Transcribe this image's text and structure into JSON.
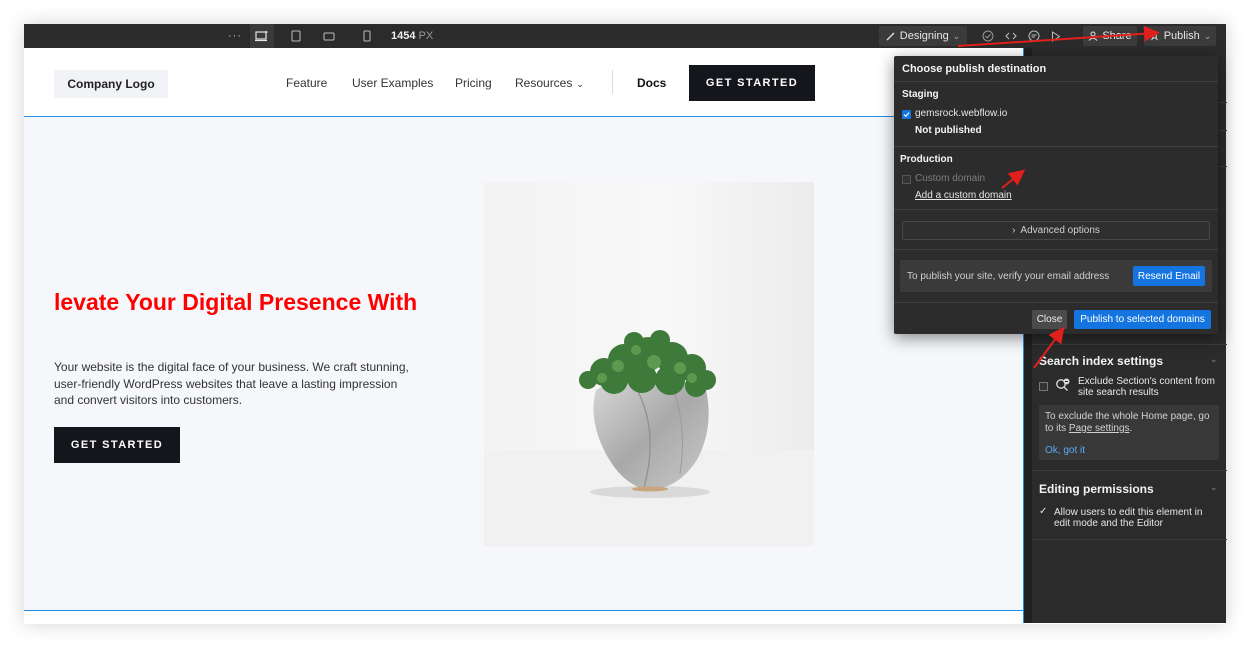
{
  "toolbar": {
    "more_label": "···",
    "width_value": "1454",
    "width_unit": "PX",
    "mode_label": "Designing",
    "share_label": "Share",
    "publish_label": "Publish",
    "icons": [
      "more-icon",
      "desktop-breakpoint-icon",
      "tablet-icon",
      "landscape-icon",
      "phone-icon",
      "brush-icon",
      "check-circle-icon",
      "code-icon",
      "comment-icon",
      "play-icon",
      "person-icon",
      "rocket-icon"
    ]
  },
  "site": {
    "logo": "Company Logo",
    "nav": {
      "feature": "Feature",
      "examples": "User Examples",
      "pricing": "Pricing",
      "resources": "Resources",
      "docs": "Docs",
      "cta": "GET STARTED"
    },
    "hero": {
      "title": "levate Your Digital Presence With",
      "text": "Your website is the digital face of your business. We craft stunning, user-friendly WordPress websites that leave a lasting impression and convert visitors into customers.",
      "cta": "GET STARTED"
    }
  },
  "publish_popover": {
    "title": "Choose publish destination",
    "staging_heading": "Staging",
    "staging_domain": "gemsrock.webflow.io",
    "staging_status": "Not published",
    "production_heading": "Production",
    "custom_domain": "Custom domain",
    "add_custom_domain": "Add a custom domain",
    "advanced_options": "Advanced options",
    "verify_text": "To publish your site, verify your email address",
    "resend_email": "Resend Email",
    "close": "Close",
    "publish_selected": "Publish to selected domains"
  },
  "right_panel": {
    "search_title": "Search index settings",
    "exclude_label": "Exclude Section's content from site search results",
    "note_text_prefix": "To exclude the whole Home page, go to its ",
    "note_link": "Page settings",
    "note_suffix": ".",
    "ok_label": "Ok, got it",
    "edit_title": "Editing permissions",
    "edit_label": "Allow users to edit this element in edit mode and the Editor"
  },
  "colors": {
    "topbar": "#2b2b2b",
    "panel": "#2b2b2b",
    "accent_blue": "#1475e1",
    "selection_blue": "#1f8eea",
    "hero_title": "#ff0000",
    "annotation_arrow": "#e0201c",
    "button_dark": "#14161b"
  }
}
